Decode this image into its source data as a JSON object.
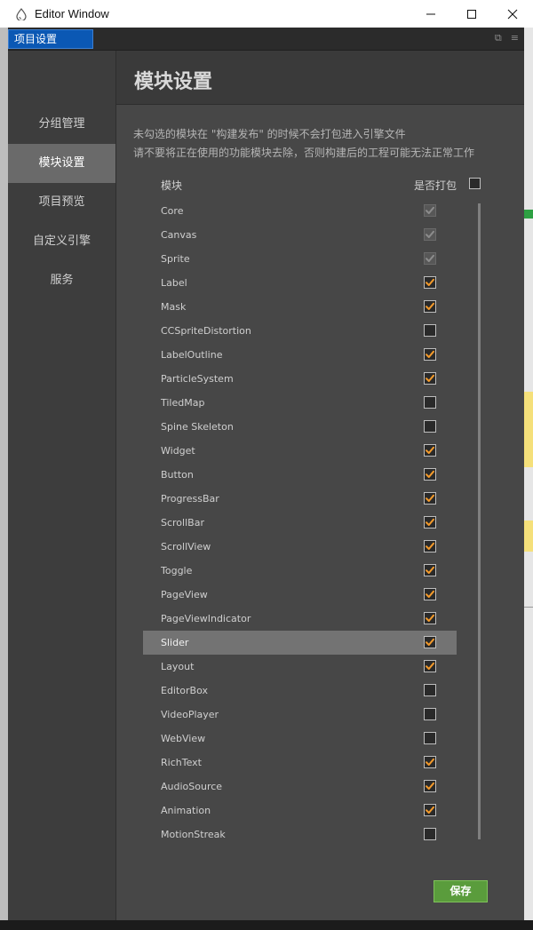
{
  "window": {
    "title": "Editor Window",
    "minimize": "—",
    "maximize": "☐",
    "close": "✕"
  },
  "tab": {
    "label": "项目设置"
  },
  "sidebar": {
    "items": [
      {
        "label": "分组管理",
        "active": false
      },
      {
        "label": "模块设置",
        "active": true
      },
      {
        "label": "项目预览",
        "active": false
      },
      {
        "label": "自定义引擎",
        "active": false
      },
      {
        "label": "服务",
        "active": false
      }
    ]
  },
  "main": {
    "title": "模块设置",
    "desc1": "未勾选的模块在 \"构建发布\" 的时候不会打包进入引擎文件",
    "desc2": "请不要将正在使用的功能模块去除，否则构建后的工程可能无法正常工作",
    "col_module": "模块",
    "col_pack": "是否打包",
    "save_label": "保存"
  },
  "modules": [
    {
      "name": "Core",
      "checked": true,
      "disabled": true
    },
    {
      "name": "Canvas",
      "checked": true,
      "disabled": true
    },
    {
      "name": "Sprite",
      "checked": true,
      "disabled": true
    },
    {
      "name": "Label",
      "checked": true
    },
    {
      "name": "Mask",
      "checked": true
    },
    {
      "name": "CCSpriteDistortion",
      "checked": false
    },
    {
      "name": "LabelOutline",
      "checked": true
    },
    {
      "name": "ParticleSystem",
      "checked": true
    },
    {
      "name": "TiledMap",
      "checked": false
    },
    {
      "name": "Spine Skeleton",
      "checked": false
    },
    {
      "name": "Widget",
      "checked": true
    },
    {
      "name": "Button",
      "checked": true
    },
    {
      "name": "ProgressBar",
      "checked": true
    },
    {
      "name": "ScrollBar",
      "checked": true
    },
    {
      "name": "ScrollView",
      "checked": true
    },
    {
      "name": "Toggle",
      "checked": true
    },
    {
      "name": "PageView",
      "checked": true
    },
    {
      "name": "PageViewIndicator",
      "checked": true
    },
    {
      "name": "Slider",
      "checked": true,
      "selected": true
    },
    {
      "name": "Layout",
      "checked": true
    },
    {
      "name": "EditorBox",
      "checked": false
    },
    {
      "name": "VideoPlayer",
      "checked": false
    },
    {
      "name": "WebView",
      "checked": false
    },
    {
      "name": "RichText",
      "checked": true
    },
    {
      "name": "AudioSource",
      "checked": true
    },
    {
      "name": "Animation",
      "checked": true
    },
    {
      "name": "MotionStreak",
      "checked": false
    }
  ],
  "colors": {
    "check_orange": "#f39a2b",
    "check_disabled": "#8c8c8c",
    "tab_blue": "#0b58b4",
    "save_green": "#5a9c3c"
  }
}
